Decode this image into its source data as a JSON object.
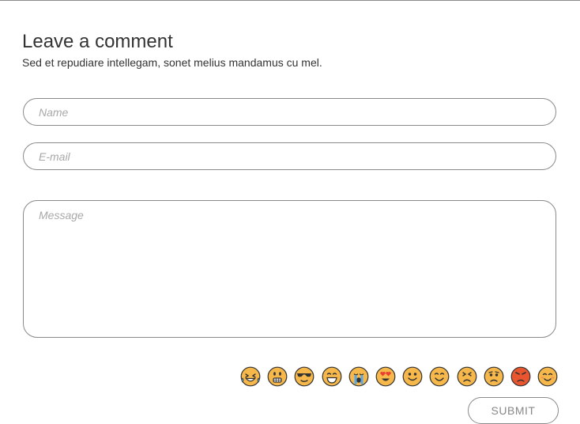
{
  "form": {
    "title": "Leave a comment",
    "subtitle": "Sed et repudiare intellegam, sonet melius mandamus cu mel.",
    "name_placeholder": "Name",
    "name_value": "",
    "email_placeholder": "E-mail",
    "email_value": "",
    "message_placeholder": "Message",
    "message_value": "",
    "submit_label": "SUBMIT"
  },
  "emojis": [
    {
      "name": "laughing-tears-icon"
    },
    {
      "name": "grimacing-icon"
    },
    {
      "name": "sunglasses-icon"
    },
    {
      "name": "grinning-squint-icon"
    },
    {
      "name": "crying-icon"
    },
    {
      "name": "heart-eyes-icon"
    },
    {
      "name": "smiling-icon"
    },
    {
      "name": "grin-icon"
    },
    {
      "name": "persevering-icon"
    },
    {
      "name": "worried-icon"
    },
    {
      "name": "angry-icon"
    },
    {
      "name": "blushing-icon"
    }
  ],
  "colors": {
    "emoji_face": "#f7b84b",
    "emoji_angry_face": "#e9552f",
    "emoji_outline": "#333333",
    "border": "#8a8a8a",
    "placeholder": "#a8a8a8"
  }
}
